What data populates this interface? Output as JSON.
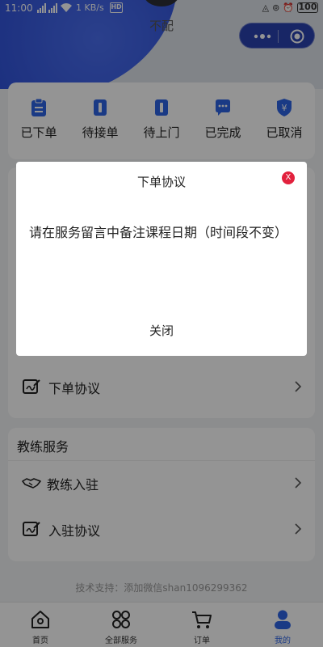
{
  "status_bar": {
    "time": "11:00",
    "speed": "1 KB/s",
    "battery": "100"
  },
  "header": {
    "username": "不配"
  },
  "order_status": [
    {
      "label": "已下单",
      "icon": "clipboard-icon"
    },
    {
      "label": "待接单",
      "icon": "receipt-icon"
    },
    {
      "label": "待上门",
      "icon": "door-icon"
    },
    {
      "label": "已完成",
      "icon": "chat-bubble-icon"
    },
    {
      "label": "已取消",
      "icon": "yen-shield-icon"
    }
  ],
  "menu": {
    "order_agreement": "下单协议"
  },
  "coach_section": {
    "title": "教练服务",
    "items": [
      {
        "label": "教练入驻",
        "icon": "handshake-icon"
      },
      {
        "label": "入驻协议",
        "icon": "sign-icon"
      }
    ]
  },
  "footer": {
    "support_text": "技术支持：添加微信shan1096299362"
  },
  "tabbar": [
    {
      "label": "首页",
      "icon": "home-icon"
    },
    {
      "label": "全部服务",
      "icon": "grid-icon"
    },
    {
      "label": "订单",
      "icon": "cart-icon"
    },
    {
      "label": "我的",
      "icon": "user-icon"
    }
  ],
  "modal": {
    "title": "下单协议",
    "close_symbol": "X",
    "body": "请在服务留言中备注课程日期（时间段不变）",
    "button": "关闭"
  },
  "colors": {
    "accent": "#2e64e6",
    "modal_close": "#e2213d"
  }
}
